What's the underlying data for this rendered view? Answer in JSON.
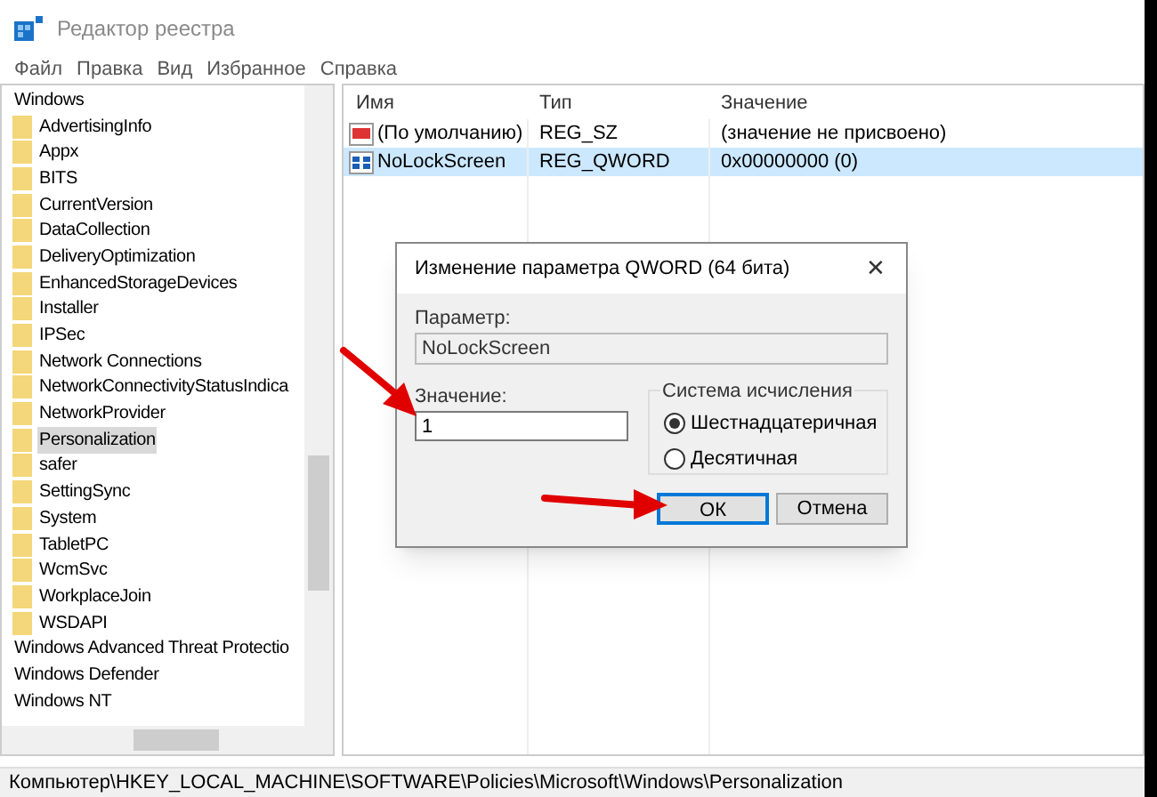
{
  "window": {
    "title": "Редактор реестра"
  },
  "menu": [
    "Файл",
    "Правка",
    "Вид",
    "Избранное",
    "Справка"
  ],
  "tree": {
    "items": [
      {
        "label": "Windows",
        "selected": false,
        "children": [
          {
            "label": "AdvertisingInfo",
            "selected": false
          },
          {
            "label": "Appx",
            "selected": false
          },
          {
            "label": "BITS",
            "selected": false
          },
          {
            "label": "CurrentVersion",
            "selected": false
          },
          {
            "label": "DataCollection",
            "selected": false
          },
          {
            "label": "DeliveryOptimization",
            "selected": false
          },
          {
            "label": "EnhancedStorageDevices",
            "selected": false
          },
          {
            "label": "Installer",
            "selected": false
          },
          {
            "label": "IPSec",
            "selected": false
          },
          {
            "label": "Network Connections",
            "selected": false
          },
          {
            "label": "NetworkConnectivityStatusIndica",
            "selected": false
          },
          {
            "label": "NetworkProvider",
            "selected": false
          },
          {
            "label": "Personalization",
            "selected": true
          },
          {
            "label": "safer",
            "selected": false
          },
          {
            "label": "SettingSync",
            "selected": false
          },
          {
            "label": "System",
            "selected": false
          },
          {
            "label": "TabletPC",
            "selected": false
          },
          {
            "label": "WcmSvc",
            "selected": false
          },
          {
            "label": "WorkplaceJoin",
            "selected": false
          },
          {
            "label": "WSDAPI",
            "selected": false
          }
        ]
      },
      {
        "label": "Windows Advanced Threat Protectio",
        "selected": false
      },
      {
        "label": "Windows Defender",
        "selected": false
      },
      {
        "label": "Windows NT",
        "selected": false
      }
    ]
  },
  "list": {
    "columns": [
      "Имя",
      "Тип",
      "Значение"
    ],
    "rows": [
      {
        "kind": "string",
        "name": "(По умолчанию)",
        "type": "REG_SZ",
        "value": "(значение не присвоено)",
        "selected": false
      },
      {
        "kind": "binary",
        "name": "NoLockScreen",
        "type": "REG_QWORD",
        "value": "0x00000000 (0)",
        "selected": true
      }
    ]
  },
  "dialog": {
    "title": "Изменение параметра QWORD (64 бита)",
    "close": "✕",
    "name_label": "Параметр:",
    "name_value": "NoLockScreen",
    "value_label": "Значение:",
    "value": "1",
    "base_label": "Система исчисления",
    "radios": [
      {
        "label": "Шестнадцатеричная",
        "selected": true
      },
      {
        "label": "Десятичная",
        "selected": false
      }
    ],
    "buttons": [
      {
        "label": "ОК",
        "default": true
      },
      {
        "label": "Отмена",
        "default": false
      }
    ]
  },
  "status_bar": "Компьютер\\HKEY_LOCAL_MACHINE\\SOFTWARE\\Policies\\Microsoft\\Windows\\Personalization"
}
